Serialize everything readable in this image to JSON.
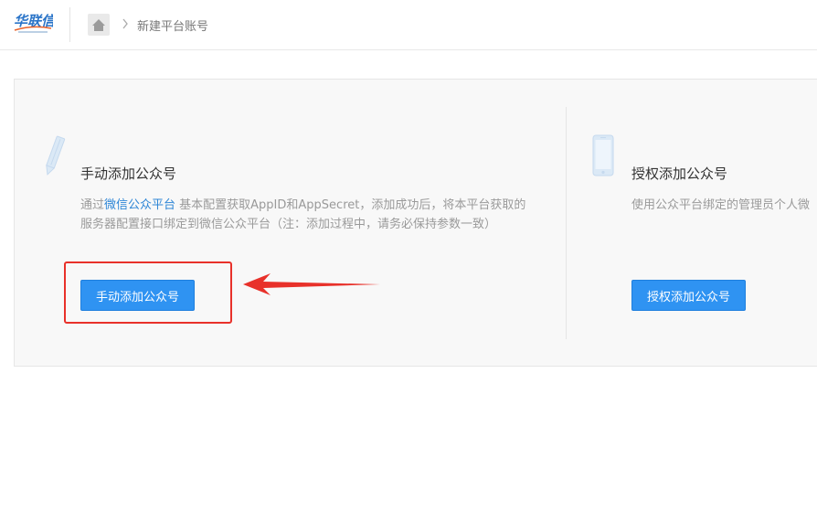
{
  "header": {
    "logo_text": "华联信",
    "breadcrumb_current": "新建平台账号"
  },
  "manual_card": {
    "title": "手动添加公众号",
    "desc_prefix": "通过",
    "desc_link": "微信公众平台",
    "desc_suffix": " 基本配置获取AppID和AppSecret，添加成功后，将本平台获取的服务器配置接口绑定到微信公众平台（注：添加过程中，请务必保持参数一致）",
    "button_label": "手动添加公众号"
  },
  "auth_card": {
    "title": "授权添加公众号",
    "desc": "使用公众平台绑定的管理员个人微",
    "button_label": "授权添加公众号"
  },
  "colors": {
    "primary": "#2f93f2",
    "annotation": "#e8312a",
    "link": "#2e86d6"
  },
  "icons": {
    "home": "home-icon",
    "pen": "pen-icon",
    "phone": "phone-icon"
  }
}
